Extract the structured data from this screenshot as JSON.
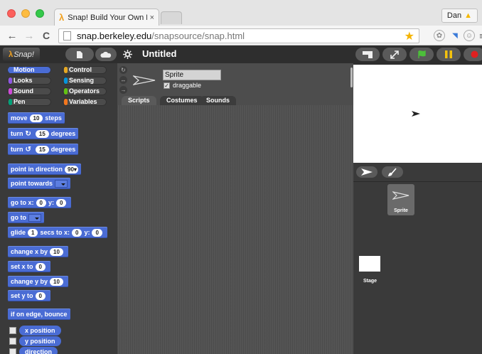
{
  "browser": {
    "tab_title": "Snap! Build Your Own Bloc",
    "tab_close": "×",
    "user": "Dan",
    "url_host": "snap.berkeley.edu",
    "url_path": "/snapsource/snap.html",
    "back": "←",
    "forward": "→",
    "reload": "C",
    "warning": "▲"
  },
  "snap": {
    "logo_text": "Snap!",
    "project_title": "Untitled"
  },
  "categories": [
    {
      "label": "Motion",
      "color": "#4a6cd4"
    },
    {
      "label": "Control",
      "color": "#e6a822"
    },
    {
      "label": "Looks",
      "color": "#8f56e3"
    },
    {
      "label": "Sensing",
      "color": "#0494dc"
    },
    {
      "label": "Sound",
      "color": "#cf4ad9"
    },
    {
      "label": "Operators",
      "color": "#62c213"
    },
    {
      "label": "Pen",
      "color": "#00a178"
    },
    {
      "label": "Variables",
      "color": "#f3761d"
    }
  ],
  "blocks": {
    "move_pre": "move",
    "move_val": "10",
    "move_post": "steps",
    "turn_cw_pre": "turn",
    "turn_cw_val": "15",
    "turn_cw_post": "degrees",
    "turn_ccw_pre": "turn",
    "turn_ccw_val": "15",
    "turn_ccw_post": "degrees",
    "point_dir": "point in direction",
    "point_dir_val": "90",
    "point_towards": "point towards",
    "goto_xy_pre": "go to x:",
    "goto_xy_x": "0",
    "goto_xy_mid": "y:",
    "goto_xy_y": "0",
    "goto": "go to",
    "glide_pre": "glide",
    "glide_secs": "1",
    "glide_mid": "secs to x:",
    "glide_x": "0",
    "glide_y_label": "y:",
    "glide_y": "0",
    "change_x": "change x by",
    "change_x_val": "10",
    "set_x": "set x to",
    "set_x_val": "0",
    "change_y": "change y by",
    "change_y_val": "10",
    "set_y": "set y to",
    "set_y_val": "0",
    "bounce": "if on edge, bounce",
    "x_position": "x position",
    "y_position": "y position",
    "direction": "direction"
  },
  "sprite": {
    "name": "Sprite",
    "draggable_label": "draggable",
    "check": "✓"
  },
  "editor_tabs": [
    "Scripts",
    "Costumes",
    "Sounds"
  ],
  "corral": {
    "sprite_label": "Sprite",
    "stage_label": "Stage"
  },
  "colors": {
    "motion": "#4a6cd4",
    "green_flag": "#4cbf3a",
    "pause": "#f4c20d",
    "stop": "#e02020"
  }
}
